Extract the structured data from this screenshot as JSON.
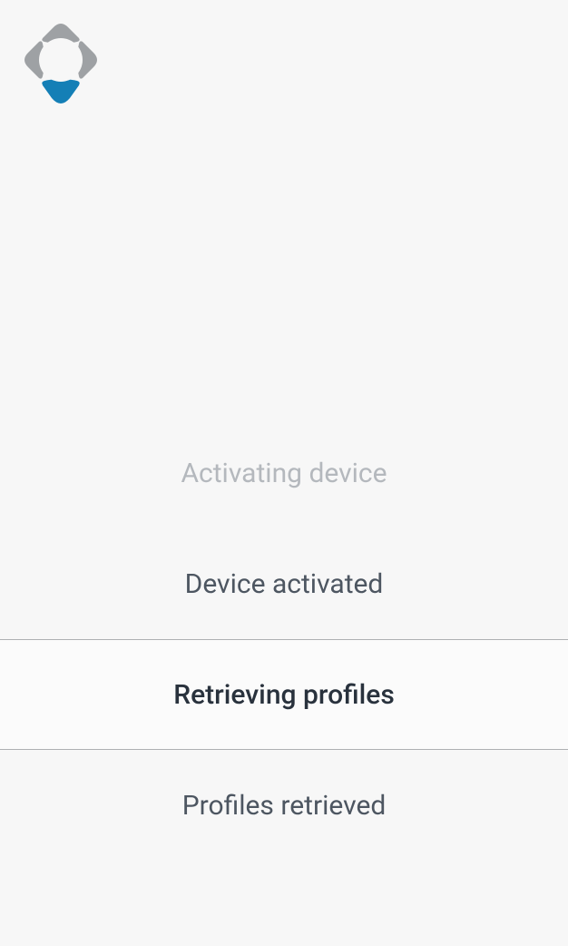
{
  "status": {
    "steps": [
      {
        "label": "Activating device",
        "state": "faded"
      },
      {
        "label": "Device activated",
        "state": "dark"
      },
      {
        "label": "Retrieving profiles",
        "state": "active"
      },
      {
        "label": "Profiles retrieved",
        "state": "dark"
      }
    ]
  }
}
